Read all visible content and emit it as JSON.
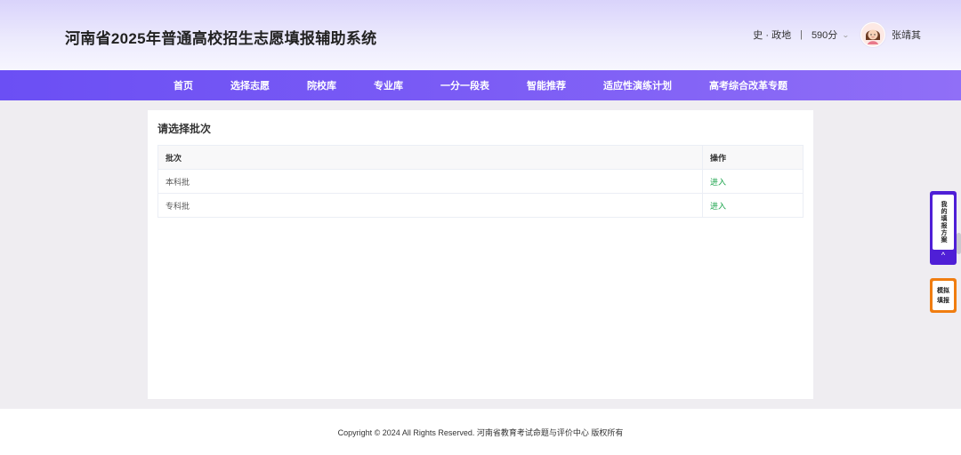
{
  "header": {
    "title": "河南省2025年普通高校招生志愿填报辅助系统",
    "subjects": "史 · 政地",
    "separator": "|",
    "score": "590分",
    "username": "张靖其"
  },
  "nav": {
    "items": [
      {
        "label": "首页"
      },
      {
        "label": "选择志愿"
      },
      {
        "label": "院校库"
      },
      {
        "label": "专业库"
      },
      {
        "label": "一分一段表"
      },
      {
        "label": "智能推荐"
      },
      {
        "label": "适应性演练计划"
      },
      {
        "label": "高考综合改革专题"
      }
    ]
  },
  "main": {
    "title": "请选择批次",
    "table": {
      "columns": [
        "批次",
        "操作"
      ],
      "rows": [
        {
          "batch": "本科批",
          "action": "进入"
        },
        {
          "batch": "专科批",
          "action": "进入"
        }
      ]
    }
  },
  "floats": {
    "plan_label": "我的填报方案",
    "plan_arrow": "^",
    "sim_line1": "模拟",
    "sim_line2": "填报"
  },
  "footer": {
    "copyright": "Copyright © 2024 All Rights Reserved. 河南省教育考试命题与评价中心  版权所有"
  },
  "colors": {
    "nav_bg": "#7b5cf5",
    "link_green": "#19a34a",
    "plan_purple": "#4f1fd6",
    "sim_orange": "#f07d10"
  },
  "icons": {
    "avatar": "avatar-icon",
    "dropdown": "chevron-down-icon",
    "scroll_top": "chevron-up-icon"
  }
}
